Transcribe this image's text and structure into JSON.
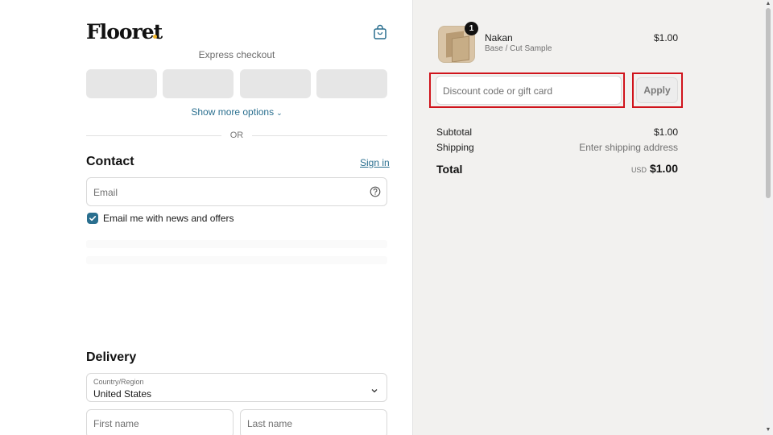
{
  "brand": {
    "name": "Flooret",
    "accent_color": "#f0b429",
    "link_color": "#2a6f8f"
  },
  "header": {
    "bag_icon": "shopping-bag-icon"
  },
  "express": {
    "label": "Express checkout",
    "show_more": "Show more options",
    "or_text": "OR"
  },
  "contact": {
    "title": "Contact",
    "sign_in": "Sign in",
    "email_placeholder": "Email",
    "help_icon": "question-circle-icon",
    "newsletter_label": "Email me with news and offers",
    "newsletter_checked": true
  },
  "delivery": {
    "title": "Delivery",
    "country_label": "Country/Region",
    "country_value": "United States",
    "first_name_placeholder": "First name",
    "last_name_placeholder": "Last name"
  },
  "order": {
    "item": {
      "name": "Nakan",
      "variant": "Base / Cut Sample",
      "price": "$1.00",
      "quantity": "1"
    },
    "discount_placeholder": "Discount code or gift card",
    "apply_label": "Apply",
    "subtotal_label": "Subtotal",
    "subtotal_value": "$1.00",
    "shipping_label": "Shipping",
    "shipping_value": "Enter shipping address",
    "total_label": "Total",
    "total_currency": "USD",
    "total_value": "$1.00"
  },
  "highlight_color": "#d0141c"
}
